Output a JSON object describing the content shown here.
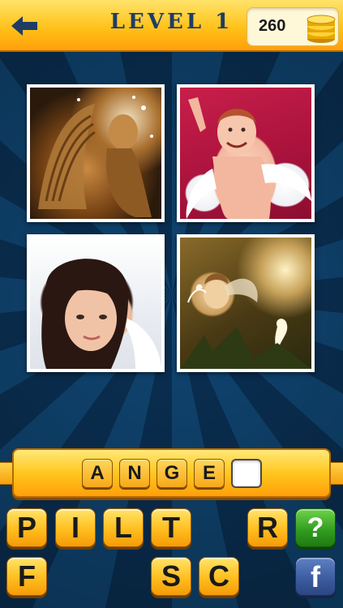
{
  "header": {
    "title": "LEVEL 1",
    "coins": "260"
  },
  "photos": [
    {
      "subject": "angel-statue"
    },
    {
      "subject": "child-with-wings"
    },
    {
      "subject": "woman-with-wings"
    },
    {
      "subject": "angel-ornament"
    }
  ],
  "answer": {
    "letters": [
      "A",
      "N",
      "G",
      "E",
      ""
    ]
  },
  "tiles": {
    "row1": [
      "P",
      "I",
      "L",
      "T",
      "R"
    ],
    "row2": [
      "F",
      "S",
      "C"
    ]
  },
  "buttons": {
    "hint": "?",
    "facebook": "f"
  },
  "colors": {
    "accent": "#ffc21a",
    "title": "#1d3d66",
    "hint": "#2f9a1e",
    "facebook": "#3b5a9e"
  }
}
